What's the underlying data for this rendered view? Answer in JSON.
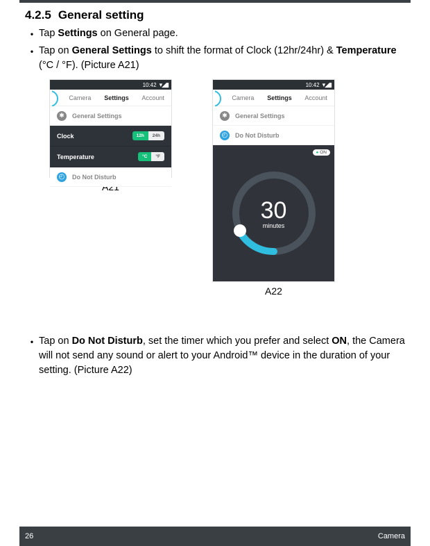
{
  "section": {
    "num": "4.2.5",
    "title": "General setting"
  },
  "bullets": {
    "b1_a": "Tap ",
    "b1_b": "Settings",
    "b1_c": " on General page.",
    "b2_a": "Tap on ",
    "b2_b": "General Settings",
    "b2_c": " to shift the format of Clock (12hr/24hr) & ",
    "b2_d": "Temperature",
    "b2_e": " (°C / °F). (Picture A21)",
    "b3_a": "Tap on ",
    "b3_b": "Do Not Disturb",
    "b3_c": ", set the timer which you prefer and select ",
    "b3_d": "ON",
    "b3_e": ", the Camera will not send any sound or alert to your Android™ device in the duration of your setting. (Picture A22)"
  },
  "captions": {
    "a21": "A21",
    "a22": "A22"
  },
  "phone": {
    "time": "10:42",
    "tabs": {
      "camera": "Camera",
      "settings": "Settings",
      "account": "Account"
    },
    "items": {
      "general": "General Settings",
      "dnd": "Do Not Disturb",
      "clock": "Clock",
      "temp": "Temperature"
    },
    "toggle12": "12h",
    "toggle24": "24h",
    "toggleC": "°C",
    "toggleF": "°F",
    "on": "ON",
    "dial_num": "30",
    "dial_unit": "minutes"
  },
  "footer": {
    "page": "26",
    "chapter": "Camera"
  }
}
